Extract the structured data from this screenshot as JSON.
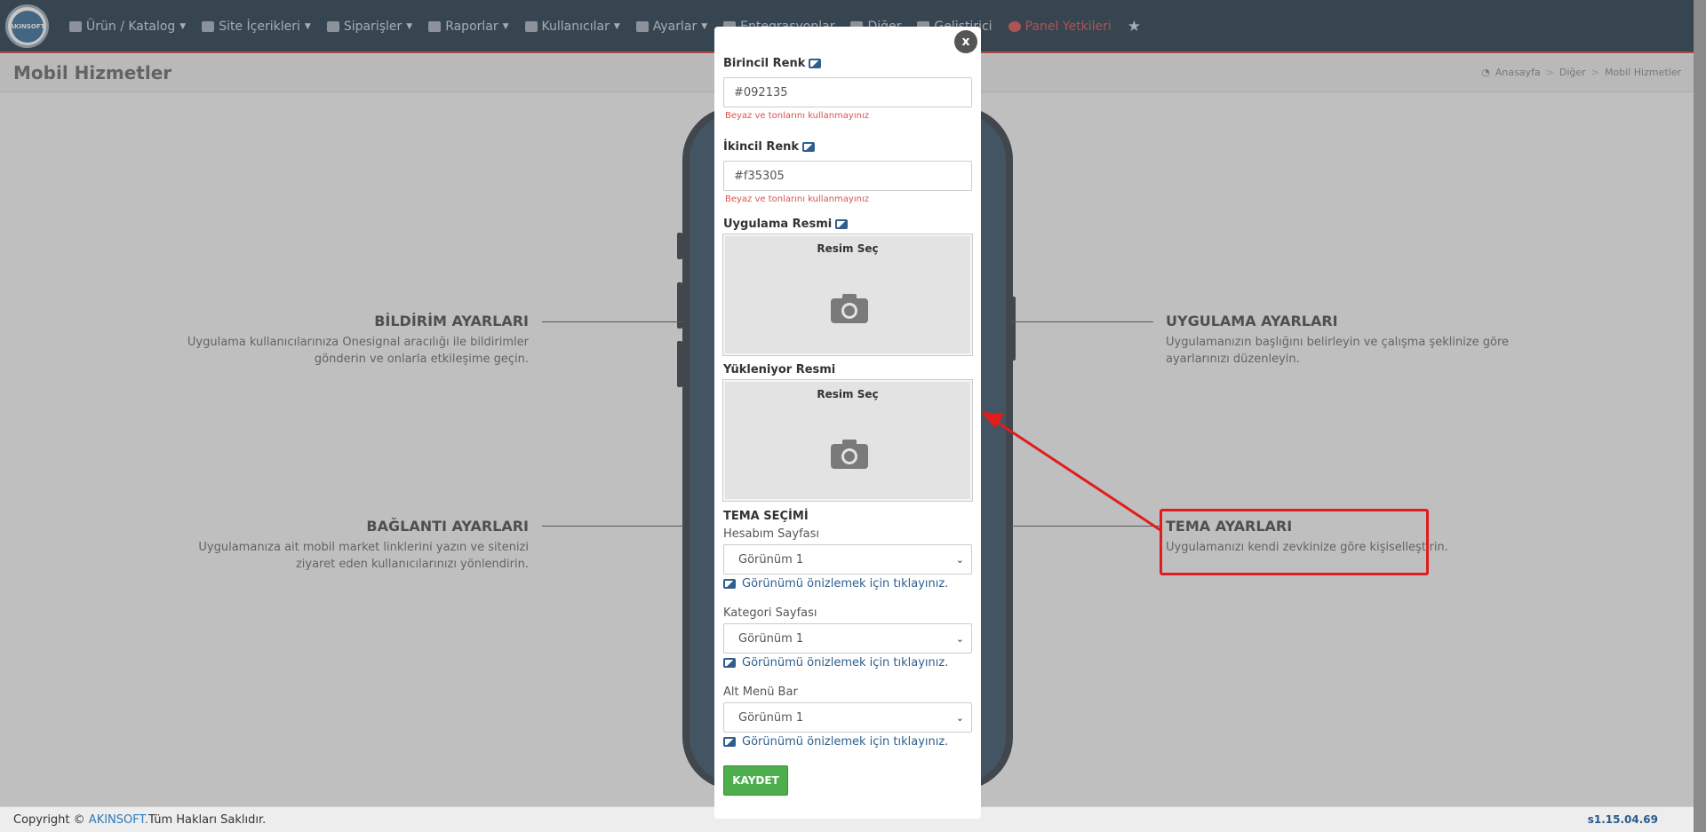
{
  "nav": {
    "logo_text": "AKINSOFT",
    "items": [
      {
        "label": "Ürün / Katalog",
        "icon": "truck-icon"
      },
      {
        "label": "Site İçerikleri",
        "icon": "file-icon"
      },
      {
        "label": "Siparişler",
        "icon": "cart-icon"
      },
      {
        "label": "Raporlar",
        "icon": "report-icon"
      },
      {
        "label": "Kullanıcılar",
        "icon": "users-icon"
      },
      {
        "label": "Ayarlar",
        "icon": "gears-icon"
      },
      {
        "label": "Entegrasyonlar",
        "icon": "sitemap-icon"
      },
      {
        "label": "Diğer",
        "icon": "file-icon"
      },
      {
        "label": "Geliştirici",
        "icon": "code-icon"
      },
      {
        "label": "Panel Yetkileri",
        "icon": "lock-icon"
      }
    ]
  },
  "header": {
    "title": "Mobil Hizmetler",
    "breadcrumb": [
      "Anasayfa",
      "Diğer",
      "Mobil Hizmetler"
    ]
  },
  "sections": {
    "bildirim": {
      "title": "BİLDİRİM AYARLARI",
      "desc_1": "Uygulama kullanıcılarınıza Onesignal aracılığı ile bildirimler",
      "desc_2": "gönderin ve onlarla etkileşime geçin."
    },
    "uygulama": {
      "title": "UYGULAMA AYARLARI",
      "desc_1": "Uygulamanızın başlığını belirleyin ve çalışma şeklinize göre",
      "desc_2": "ayarlarınızı düzenleyin."
    },
    "baglanti": {
      "title": "BAĞLANTI AYARLARI",
      "desc_1": "Uygulamanıza ait mobil market linklerini yazın ve sitenizi",
      "desc_2": "ziyaret eden kullanıcılarınızı yönlendirin."
    },
    "tema": {
      "title": "TEMA AYARLARI",
      "desc_1": "Uygulamanızı kendi zevkinize göre kişiselleştirin."
    }
  },
  "modal": {
    "close_label": "x",
    "primary_color": {
      "label": "Birincil Renk",
      "value": "#092135",
      "help": "Beyaz ve tonlarını kullanmayınız"
    },
    "secondary_color": {
      "label": "İkincil Renk",
      "value": "#f35305",
      "help": "Beyaz ve tonlarını kullanmayınız"
    },
    "app_image": {
      "label": "Uygulama Resmi",
      "pick_label": "Resim Seç"
    },
    "loading_image": {
      "label": "Yükleniyor Resmi",
      "pick_label": "Resim Seç"
    },
    "theme": {
      "title": "TEMA SEÇİMİ",
      "account_page": {
        "label": "Hesabım Sayfası",
        "value": "Görünüm 1",
        "preview": "Görünümü önizlemek için tıklayınız."
      },
      "category_page": {
        "label": "Kategori Sayfası",
        "value": "Görünüm 1",
        "preview": "Görünümü önizlemek için tıklayınız."
      },
      "bottom_bar": {
        "label": "Alt Menü Bar",
        "value": "Görünüm 1",
        "preview": "Görünümü önizlemek için tıklayınız."
      }
    },
    "save_label": "KAYDET"
  },
  "footer": {
    "copyright_prefix": "Copyright ©",
    "brand": "AKINSOFT.",
    "copyright_suffix": "Tüm Hakları Saklıdır.",
    "version": "s1.15.04.69"
  },
  "colors": {
    "navbar": "#092135",
    "accent_red": "#e21c1c",
    "save_green": "#4cae4c",
    "link_blue": "#2f5f8f"
  }
}
